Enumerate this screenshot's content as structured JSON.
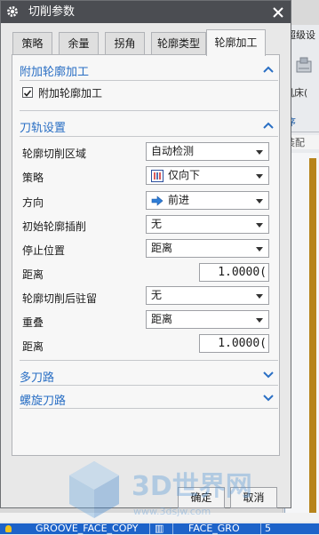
{
  "background": {
    "tab_label": "超级设",
    "machine_label": "机床(",
    "order_label": "序",
    "assembly_label": "装配",
    "row_name": "GROOVE_FACE_COPY",
    "row_col2": "FACE_GRO",
    "row_col3": "5"
  },
  "dialog": {
    "title": "切削参数",
    "tabs": [
      "策略",
      "余量",
      "拐角",
      "轮廓类型",
      "轮廓加工"
    ],
    "active_tab_index": 4
  },
  "sections": {
    "additional_profile": {
      "header": "附加轮廓加工",
      "checkbox_label": "附加轮廓加工",
      "checked": true
    },
    "toolpath_settings": {
      "header": "刀轨设置",
      "rows": {
        "profile_cut_region": {
          "label": "轮廓切削区域",
          "value": "自动检测"
        },
        "strategy": {
          "label": "策略",
          "value": "仅向下"
        },
        "direction": {
          "label": "方向",
          "value": "前进"
        },
        "initial_profile_plunge": {
          "label": "初始轮廓插削",
          "value": "无"
        },
        "stop_position": {
          "label": "停止位置",
          "value": "距离"
        },
        "distance_1": {
          "label": "距离",
          "value": "1.0000("
        },
        "dwell_after_profile_cut": {
          "label": "轮廓切削后驻留",
          "value": "无"
        },
        "overlap": {
          "label": "重叠",
          "value": "距离"
        },
        "distance_2": {
          "label": "距离",
          "value": "1.0000("
        }
      }
    },
    "multiple_paths": {
      "header": "多刀路"
    },
    "spiral_path": {
      "header": "螺旋刀路"
    }
  },
  "buttons": {
    "ok": "确定",
    "cancel": "取消"
  },
  "watermark": {
    "text": "3D世界网",
    "url": "www.3dsjw.com"
  },
  "colors": {
    "titlebar": "#4b4d52",
    "section_header": "#2a6fc4",
    "selected_row": "#1d63c9"
  }
}
